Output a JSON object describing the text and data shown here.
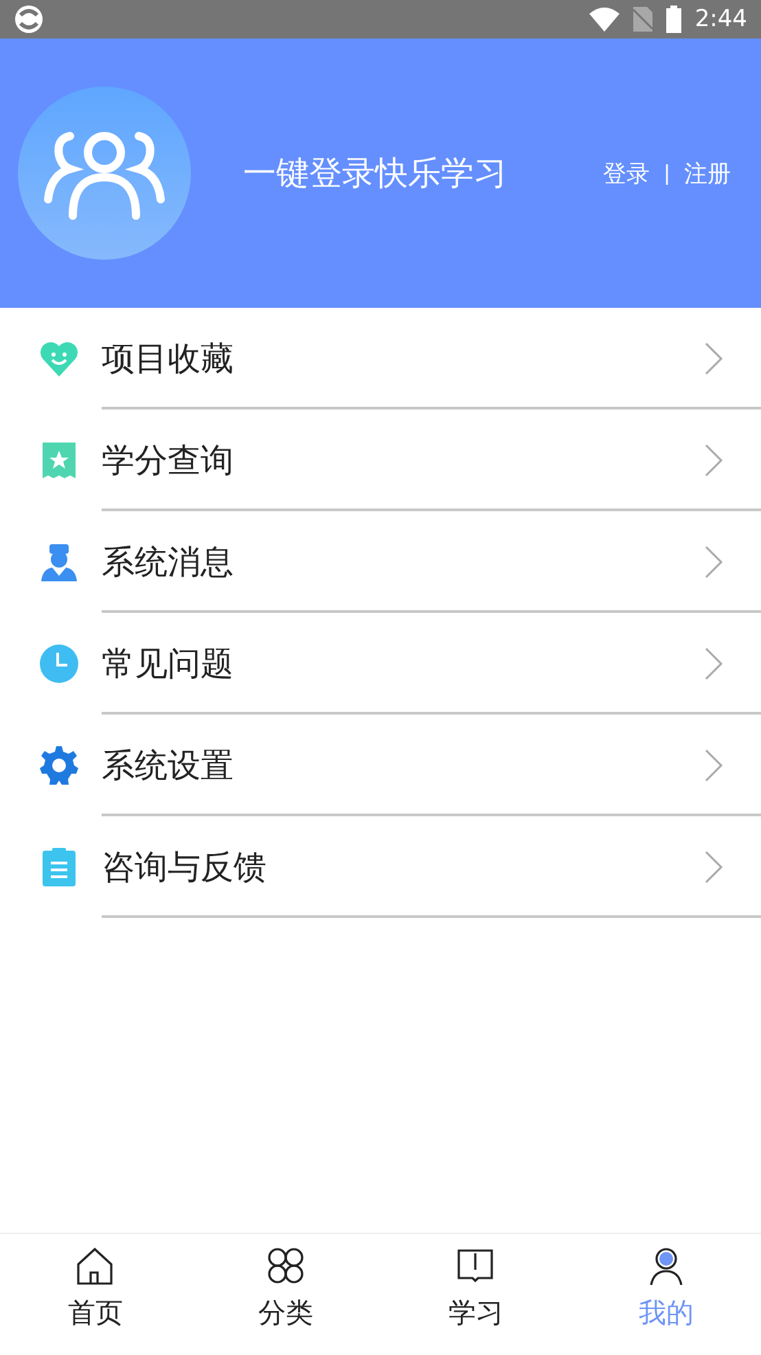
{
  "status_bar": {
    "time": "2:44"
  },
  "header": {
    "slogan": "一键登录快乐学习",
    "login": "登录",
    "separator": "|",
    "register": "注册"
  },
  "menu": [
    {
      "kind": "heart",
      "label": "项目收藏"
    },
    {
      "kind": "ticket",
      "label": "学分查询"
    },
    {
      "kind": "nurse",
      "label": "系统消息"
    },
    {
      "kind": "clock",
      "label": "常见问题"
    },
    {
      "kind": "gear",
      "label": "系统设置"
    },
    {
      "kind": "clipboard",
      "label": "咨询与反馈"
    }
  ],
  "tabs": [
    {
      "kind": "home",
      "label": "首页",
      "selected": false
    },
    {
      "kind": "grid",
      "label": "分类",
      "selected": false
    },
    {
      "kind": "book",
      "label": "学习",
      "selected": false
    },
    {
      "kind": "user",
      "label": "我的",
      "selected": true
    }
  ]
}
